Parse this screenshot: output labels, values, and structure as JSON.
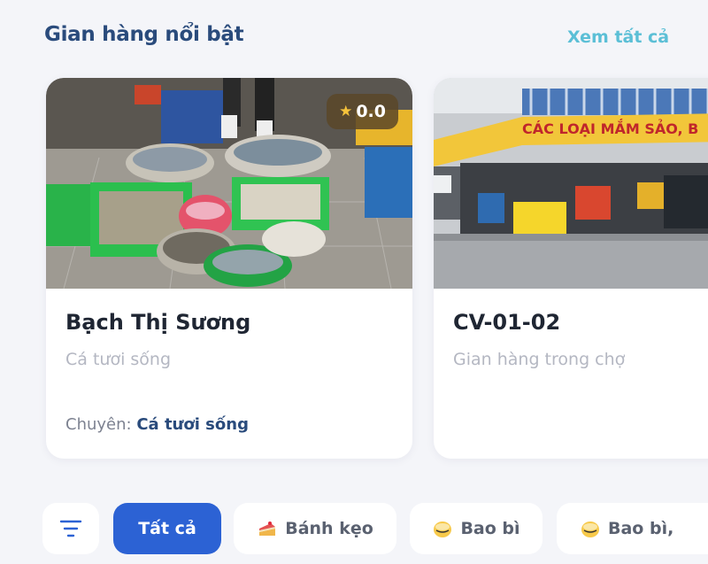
{
  "header": {
    "title": "Gian hàng nổi bật",
    "see_all": "Xem tất cả"
  },
  "stores": [
    {
      "name": "Bạch Thị Sương",
      "category": "Cá tươi sống",
      "rating": "0.0",
      "specialty_label": "Chuyên:",
      "specialty_value": "Cá tươi sống",
      "image_icon": "fish-stall-photo"
    },
    {
      "name": "CV-01-02",
      "category": "Gian hàng trong chợ",
      "image_icon": "market-stall-photo",
      "image_sign": "CÁC LOẠI MẮM SẢO, B"
    }
  ],
  "filters": {
    "filter_icon": "filter-icon",
    "chips": [
      {
        "label": "Tất cả",
        "active": true
      },
      {
        "label": "Bánh kẹo",
        "icon": "cake-icon"
      },
      {
        "label": "Bao bì",
        "icon": "package-icon"
      },
      {
        "label": "Bao bì,",
        "icon": "package-icon"
      }
    ]
  },
  "colors": {
    "accent": "#2c62d4",
    "title": "#2a4b7c",
    "link": "#5bbfd6",
    "background": "#f4f5f9"
  }
}
